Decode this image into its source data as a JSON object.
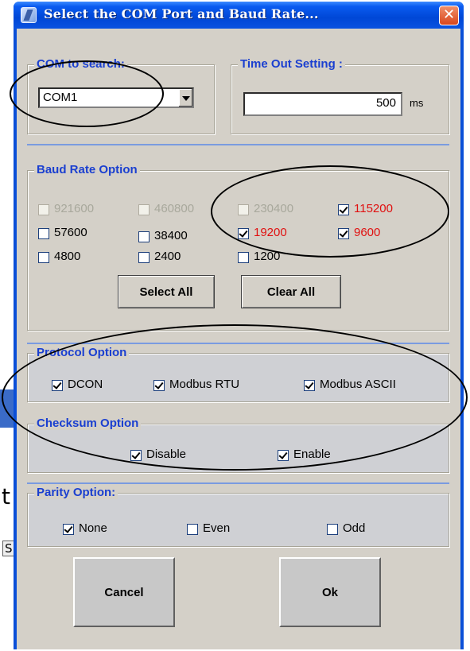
{
  "window": {
    "title": "Select the COM Port and Baud Rate..."
  },
  "com": {
    "legend": "COM to search:",
    "value": "COM1"
  },
  "timeout": {
    "legend": "Time Out Setting :",
    "value": "500",
    "unit": "ms"
  },
  "baud": {
    "legend": "Baud Rate Option",
    "rates": [
      {
        "label": "921600",
        "checked": false,
        "state": "disabled"
      },
      {
        "label": "460800",
        "checked": false,
        "state": "disabled"
      },
      {
        "label": "230400",
        "checked": false,
        "state": "disabled"
      },
      {
        "label": "115200",
        "checked": true,
        "state": "highlight"
      },
      {
        "label": "57600",
        "checked": false,
        "state": "normal"
      },
      {
        "label": "38400",
        "checked": false,
        "state": "normal"
      },
      {
        "label": "19200",
        "checked": true,
        "state": "highlight"
      },
      {
        "label": "9600",
        "checked": true,
        "state": "highlight"
      },
      {
        "label": "4800",
        "checked": false,
        "state": "normal"
      },
      {
        "label": "2400",
        "checked": false,
        "state": "normal"
      },
      {
        "label": "1200",
        "checked": false,
        "state": "normal"
      }
    ],
    "select_all": "Select All",
    "clear_all": "Clear All"
  },
  "protocol": {
    "legend": "Protocol Option",
    "options": [
      {
        "label": "DCON",
        "checked": true
      },
      {
        "label": "Modbus RTU",
        "checked": true
      },
      {
        "label": "Modbus ASCII",
        "checked": true
      }
    ]
  },
  "checksum": {
    "legend": "Checksum  Option",
    "options": [
      {
        "label": "Disable",
        "checked": true
      },
      {
        "label": "Enable",
        "checked": true
      }
    ]
  },
  "parity": {
    "legend": "Parity Option:",
    "options": [
      {
        "label": "None",
        "checked": true
      },
      {
        "label": "Even",
        "checked": false
      },
      {
        "label": "Odd",
        "checked": false
      }
    ]
  },
  "buttons": {
    "cancel": "Cancel",
    "ok": "Ok"
  },
  "background": {
    "frag1": "t",
    "frag2": "S"
  },
  "colors": {
    "legend": "#1a3fd0",
    "highlight": "#e01010",
    "title_bar": "#0047d6"
  }
}
